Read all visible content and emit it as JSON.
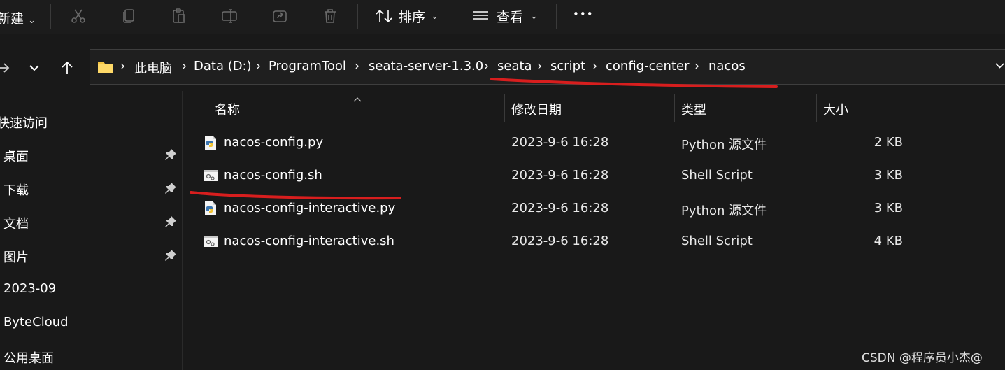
{
  "toolbar": {
    "new_label": "新建",
    "sort_label": "排序",
    "view_label": "查看",
    "more_label": "•••",
    "chevron": "⌄"
  },
  "breadcrumbs": [
    "此电脑",
    "Data (D:)",
    "ProgramTool",
    "seata-server-1.3.0",
    "seata",
    "script",
    "config-center",
    "nacos"
  ],
  "breadcrumb_separator": "›",
  "sidebar": {
    "items": [
      {
        "label": "快速访问",
        "pinned": false
      },
      {
        "label": "桌面",
        "pinned": true
      },
      {
        "label": "下载",
        "pinned": true
      },
      {
        "label": "文档",
        "pinned": true
      },
      {
        "label": "图片",
        "pinned": true
      },
      {
        "label": "2023-09",
        "pinned": false
      },
      {
        "label": "ByteCloud",
        "pinned": false
      },
      {
        "label": "公用桌面",
        "pinned": false
      }
    ]
  },
  "columns": {
    "name": "名称",
    "modified": "修改日期",
    "type": "类型",
    "size": "大小"
  },
  "files": [
    {
      "name": "nacos-config.py",
      "modified": "2023-9-6 16:28",
      "type": "Python 源文件",
      "size": "2 KB",
      "icon": "python-file-icon"
    },
    {
      "name": "nacos-config.sh",
      "modified": "2023-9-6 16:28",
      "type": "Shell Script",
      "size": "3 KB",
      "icon": "shell-script-icon"
    },
    {
      "name": "nacos-config-interactive.py",
      "modified": "2023-9-6 16:28",
      "type": "Python 源文件",
      "size": "3 KB",
      "icon": "python-file-icon"
    },
    {
      "name": "nacos-config-interactive.sh",
      "modified": "2023-9-6 16:28",
      "type": "Shell Script",
      "size": "4 KB",
      "icon": "shell-script-icon"
    }
  ],
  "watermark": "CSDN @程序员小杰@",
  "colors": {
    "background": "#191919",
    "annotation_red": "#d81e1e",
    "folder_yellow": "#f5c542"
  }
}
